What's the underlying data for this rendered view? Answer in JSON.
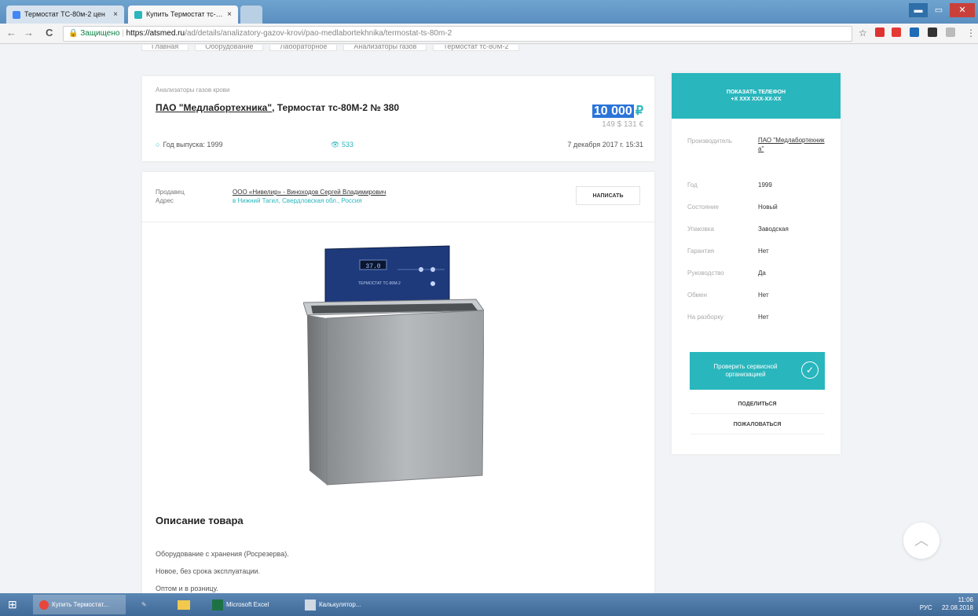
{
  "browser": {
    "tabs": [
      {
        "label": "Термостат ТС-80м-2 цен",
        "close": "×",
        "color": "#4285f4"
      },
      {
        "label": "Купить Термостат тс-8С",
        "close": "×",
        "color": "#29b6bd"
      }
    ],
    "window_controls": {
      "minimize": "▬",
      "maximize": "▭",
      "close": "✕"
    },
    "nav": {
      "back": "←",
      "forward": "→",
      "reload": "C"
    },
    "secure_label": "🔒 Защищено",
    "url_host": "https://atsmed.ru",
    "url_path": "/ad/details/analizatory-gazov-krovi/pao-medlabortekhnika/termostat-ts-80m-2",
    "star": "☆"
  },
  "breadcrumbs": [
    "Главная",
    "Оборудование",
    "Лабораторное",
    "Анализаторы газов",
    "Термостат тс-80М-2"
  ],
  "listing": {
    "category": "Анализаторы газов крови",
    "title_link": "ПАО \"Медлабортехника\"",
    "title_rest": ", Термостат тс-80М-2 № 380",
    "price": "10 000",
    "currency": "₽",
    "alt_price": "149 $   131 €",
    "year_label": "Год выпуска: 1999",
    "views": "533",
    "date": "7 декабря 2017 г. 15:31"
  },
  "seller": {
    "seller_label": "Продавец",
    "address_label": "Адрес",
    "name": "ООО «Нивелир» - Виноходов Сергей Владимирович",
    "address": "в Нижний Тагил, Свердловская обл., Россия",
    "write_button": "НАПИСАТЬ"
  },
  "product_image": {
    "panel_label": "ТЕРМОСТАТ   ТС-80М-2",
    "display": "37.0"
  },
  "description": {
    "title": "Описание товара",
    "lines": [
      "Оборудование с хранения (Росрезерва).",
      "Новое, без срока эксплуатации.",
      "Оптом и в розницу."
    ]
  },
  "sidebar": {
    "phone_button": "ПОКАЗАТЬ ТЕЛЕФОН",
    "phone_mask": "+X XXX XXX-XX-XX",
    "specs": [
      {
        "label": "Производитель",
        "value": "ПАО \"Медлабортехник а\""
      },
      {
        "label": "Год",
        "value": "1999"
      },
      {
        "label": "Состояние",
        "value": "Новый"
      },
      {
        "label": "Упаковка",
        "value": "Заводская"
      },
      {
        "label": "Гарантия",
        "value": "Нет"
      },
      {
        "label": "Руководство",
        "value": "Да"
      },
      {
        "label": "Обмен",
        "value": "Нет"
      },
      {
        "label": "На разборку",
        "value": "Нет"
      }
    ],
    "check_button": "Проверить сервисной организацией",
    "share": "ПОДЕЛИТЬСЯ",
    "report": "ПОЖАЛОВАТЬСЯ"
  },
  "scroll_up_icon": "︿",
  "taskbar": {
    "start": "⊞",
    "items": [
      "Купить Термостат...",
      "Microsoft Excel",
      "Калькулятор..."
    ],
    "lang": "РУС",
    "time": "11:06",
    "date": "22.08.2018"
  },
  "colors": {
    "accent": "#29b6bd",
    "selection": "#2b74d9"
  }
}
